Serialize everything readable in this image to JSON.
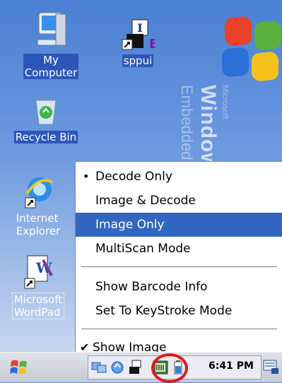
{
  "desktop": {
    "icons": [
      {
        "label_line1": "My",
        "label_line2": "Computer"
      },
      {
        "label": "sppui"
      },
      {
        "label": "Recycle Bin"
      },
      {
        "label_line1": "Internet",
        "label_line2": "Explorer"
      },
      {
        "label_line1": "Microsoft",
        "label_line2": "WordPad"
      }
    ],
    "brand_big": "Windows",
    "brand_small": "Embedded",
    "brand_tiny": "Microsoft"
  },
  "menu": {
    "items": [
      {
        "label": "Decode Only",
        "mark": "•"
      },
      {
        "label": "Image & Decode",
        "mark": ""
      },
      {
        "label": "Image Only",
        "mark": "",
        "highlighted": true
      },
      {
        "label": "MultiScan Mode",
        "mark": ""
      },
      {
        "label": "Show Barcode Info",
        "mark": ""
      },
      {
        "label": "Set To KeyStroke Mode",
        "mark": ""
      },
      {
        "label": "Show Image",
        "mark": "✔"
      }
    ]
  },
  "taskbar": {
    "clock": "6:41 PM"
  },
  "colors": {
    "highlight": "#3166c1",
    "circle": "#e0181f"
  }
}
